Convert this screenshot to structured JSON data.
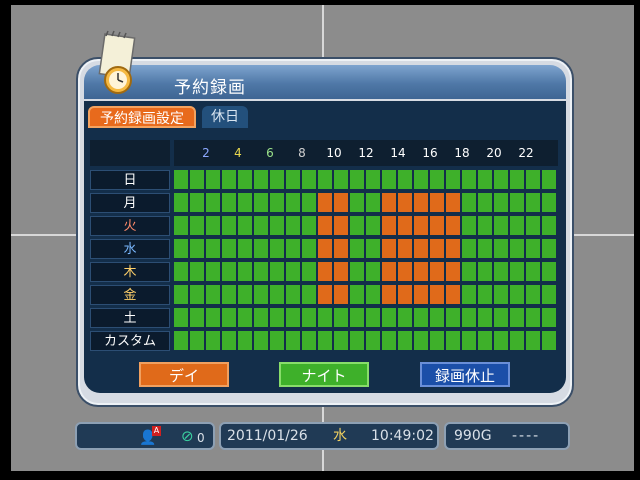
{
  "dialog": {
    "title": "予約録画",
    "tabs": [
      {
        "label": "予約録画設定"
      },
      {
        "label": "休日"
      }
    ]
  },
  "schedule": {
    "hour_labels": [
      "2",
      "4",
      "6",
      "8",
      "10",
      "12",
      "14",
      "16",
      "18",
      "20",
      "22"
    ],
    "hour_label_colors": [
      "#8ca8ff",
      "#e8d84e",
      "#9be28a",
      "#d0d0d0",
      "#ffffff",
      "#ffffff",
      "#ffffff",
      "#ffffff",
      "#ffffff",
      "#ffffff",
      "#ffffff"
    ],
    "rows": [
      "日",
      "月",
      "火",
      "水",
      "木",
      "金",
      "土",
      "カスタム"
    ],
    "row_label_colors": [
      "#ffffff",
      "#ffffff",
      "#ff8a6a",
      "#7ab8ff",
      "#ffd06a",
      "#ffd06a",
      "#ffffff",
      "#ffffff"
    ],
    "day_color": "#e06a1a",
    "night_color": "#3eb02a",
    "orange_cells": {
      "月": [
        [
          18,
          21
        ],
        [
          26,
          36
        ]
      ],
      "火": [
        [
          18,
          21
        ],
        [
          26,
          36
        ]
      ],
      "水": [
        [
          18,
          21
        ],
        [
          26,
          36
        ]
      ],
      "木": [
        [
          18,
          21
        ],
        [
          26,
          36
        ]
      ],
      "金": [
        [
          18,
          21
        ],
        [
          26,
          36
        ]
      ]
    }
  },
  "buttons": {
    "day_label": "デイ",
    "night_label": "ナイト",
    "pause_label": "録画休止"
  },
  "status_bar": {
    "channel_count": "0",
    "date": "2011/01/26",
    "weekday": "水",
    "time": "10:49:02",
    "disk": "990G",
    "extra": "----"
  }
}
